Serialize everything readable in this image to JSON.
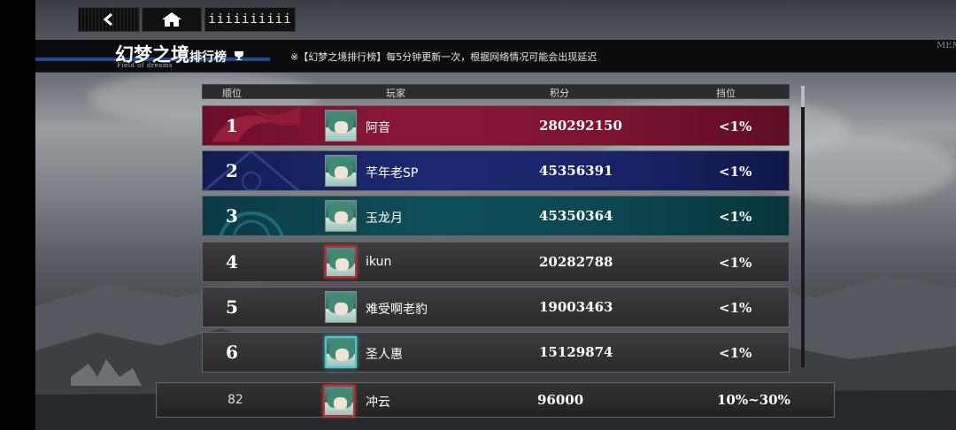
{
  "nav": {
    "back_icon": "chevron-left-icon",
    "home_icon": "home-icon",
    "menu_label": "iiiiiiiiii"
  },
  "header": {
    "title": "幻梦之境",
    "title_suffix": "排行榜",
    "title_en": "Field of dreams",
    "notice": "※【幻梦之境排行榜】每5分钟更新一次，根据网络情况可能会出现延迟",
    "side_text": "MEM OF T DEE"
  },
  "columns": [
    "顺位",
    "玩家",
    "积分",
    "挡位"
  ],
  "rows": [
    {
      "rank": "1",
      "name": "阿音",
      "score": "280292150",
      "tier": "<1%"
    },
    {
      "rank": "2",
      "name": "芊年老SP",
      "score": "45356391",
      "tier": "<1%"
    },
    {
      "rank": "3",
      "name": "玉龙月",
      "score": "45350364",
      "tier": "<1%"
    },
    {
      "rank": "4",
      "name": "ikun",
      "score": "20282788",
      "tier": "<1%"
    },
    {
      "rank": "5",
      "name": "难受啊老豹",
      "score": "19003463",
      "tier": "<1%"
    },
    {
      "rank": "6",
      "name": "圣人惠",
      "score": "15129874",
      "tier": "<1%"
    }
  ],
  "mine": {
    "rank": "82",
    "name": "冲云",
    "score": "96000",
    "tier": "10%~30%"
  },
  "colors": {
    "first": "#8b1738",
    "second": "#1d2a73",
    "third": "#0f4f58",
    "accent_line": "#1f4b9a"
  }
}
